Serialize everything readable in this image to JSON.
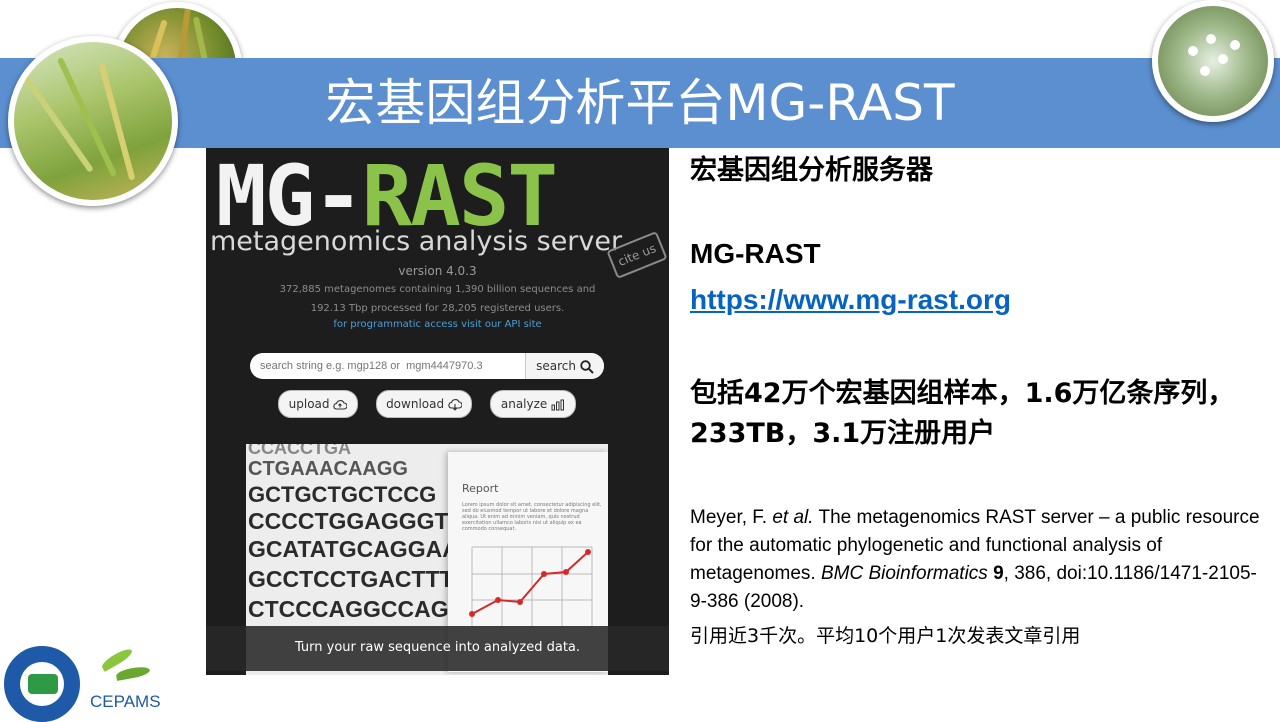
{
  "slide": {
    "title": "宏基因组分析平台MG-RAST",
    "colors": {
      "banner": "#5b8fd0",
      "link": "#0563c1"
    }
  },
  "screenshot": {
    "logo_part1": "MG-",
    "logo_part2": "RAST",
    "subtitle": "metagenomics analysis server",
    "cite": "cite us",
    "version": "version 4.0.3",
    "stats_line1": "372,885 metagenomes containing 1,390 billion sequences and",
    "stats_line2": "192.13 Tbp processed for 28,205 registered users.",
    "api_link": "for programmatic access visit our API site",
    "search_placeholder": "search string e.g. mgp128 or  mgm4447970.3",
    "search_button": "search",
    "upload": "upload",
    "download": "download",
    "analyze": "analyze",
    "dna_lines": [
      "CCACCTGA",
      "CTGAAACAAGG",
      "GCTGCTGCTCCG",
      "CCCCTGGAGGGTGG",
      "GCATATGCAGGAAGGC",
      "GCCTCCTGACTTTCCC",
      "CTCCCAGGCCAGTGCC"
    ],
    "report_title": "Report",
    "report_lorem": "Lorem ipsum dolor sit amet, consectetur adipiscing elit, sed do eiusmod tempor ut labore et dolore magna aliqua. Ut enim ad minim veniam, quis nostrud exercitation ullamco laboris nisi ut aliquip ex ea commodo consequat.",
    "caption": "Turn your raw sequence into analyzed data."
  },
  "right": {
    "heading": "宏基因组分析服务器",
    "name": "MG-RAST",
    "url": "https://www.mg-rast.org",
    "summary": "包括42万个宏基因组样本，1.6万亿条序列，233TB，3.1万注册用户",
    "ref_authors": "Meyer, F. ",
    "ref_etal": "et al.",
    "ref_title": " The metagenomics RAST server – a public resource for the automatic phylogenetic and functional analysis of metagenomes. ",
    "ref_journal": "BMC Bioinformatics",
    "ref_space": " ",
    "ref_volume": "9",
    "ref_rest": ", 386, doi:10.1186/1471-2105-9-386  (2008).",
    "citation_note": "引用近3千次。平均10个用户1次发表文章引用"
  },
  "footer": {
    "org_name": "CEPAMS"
  }
}
